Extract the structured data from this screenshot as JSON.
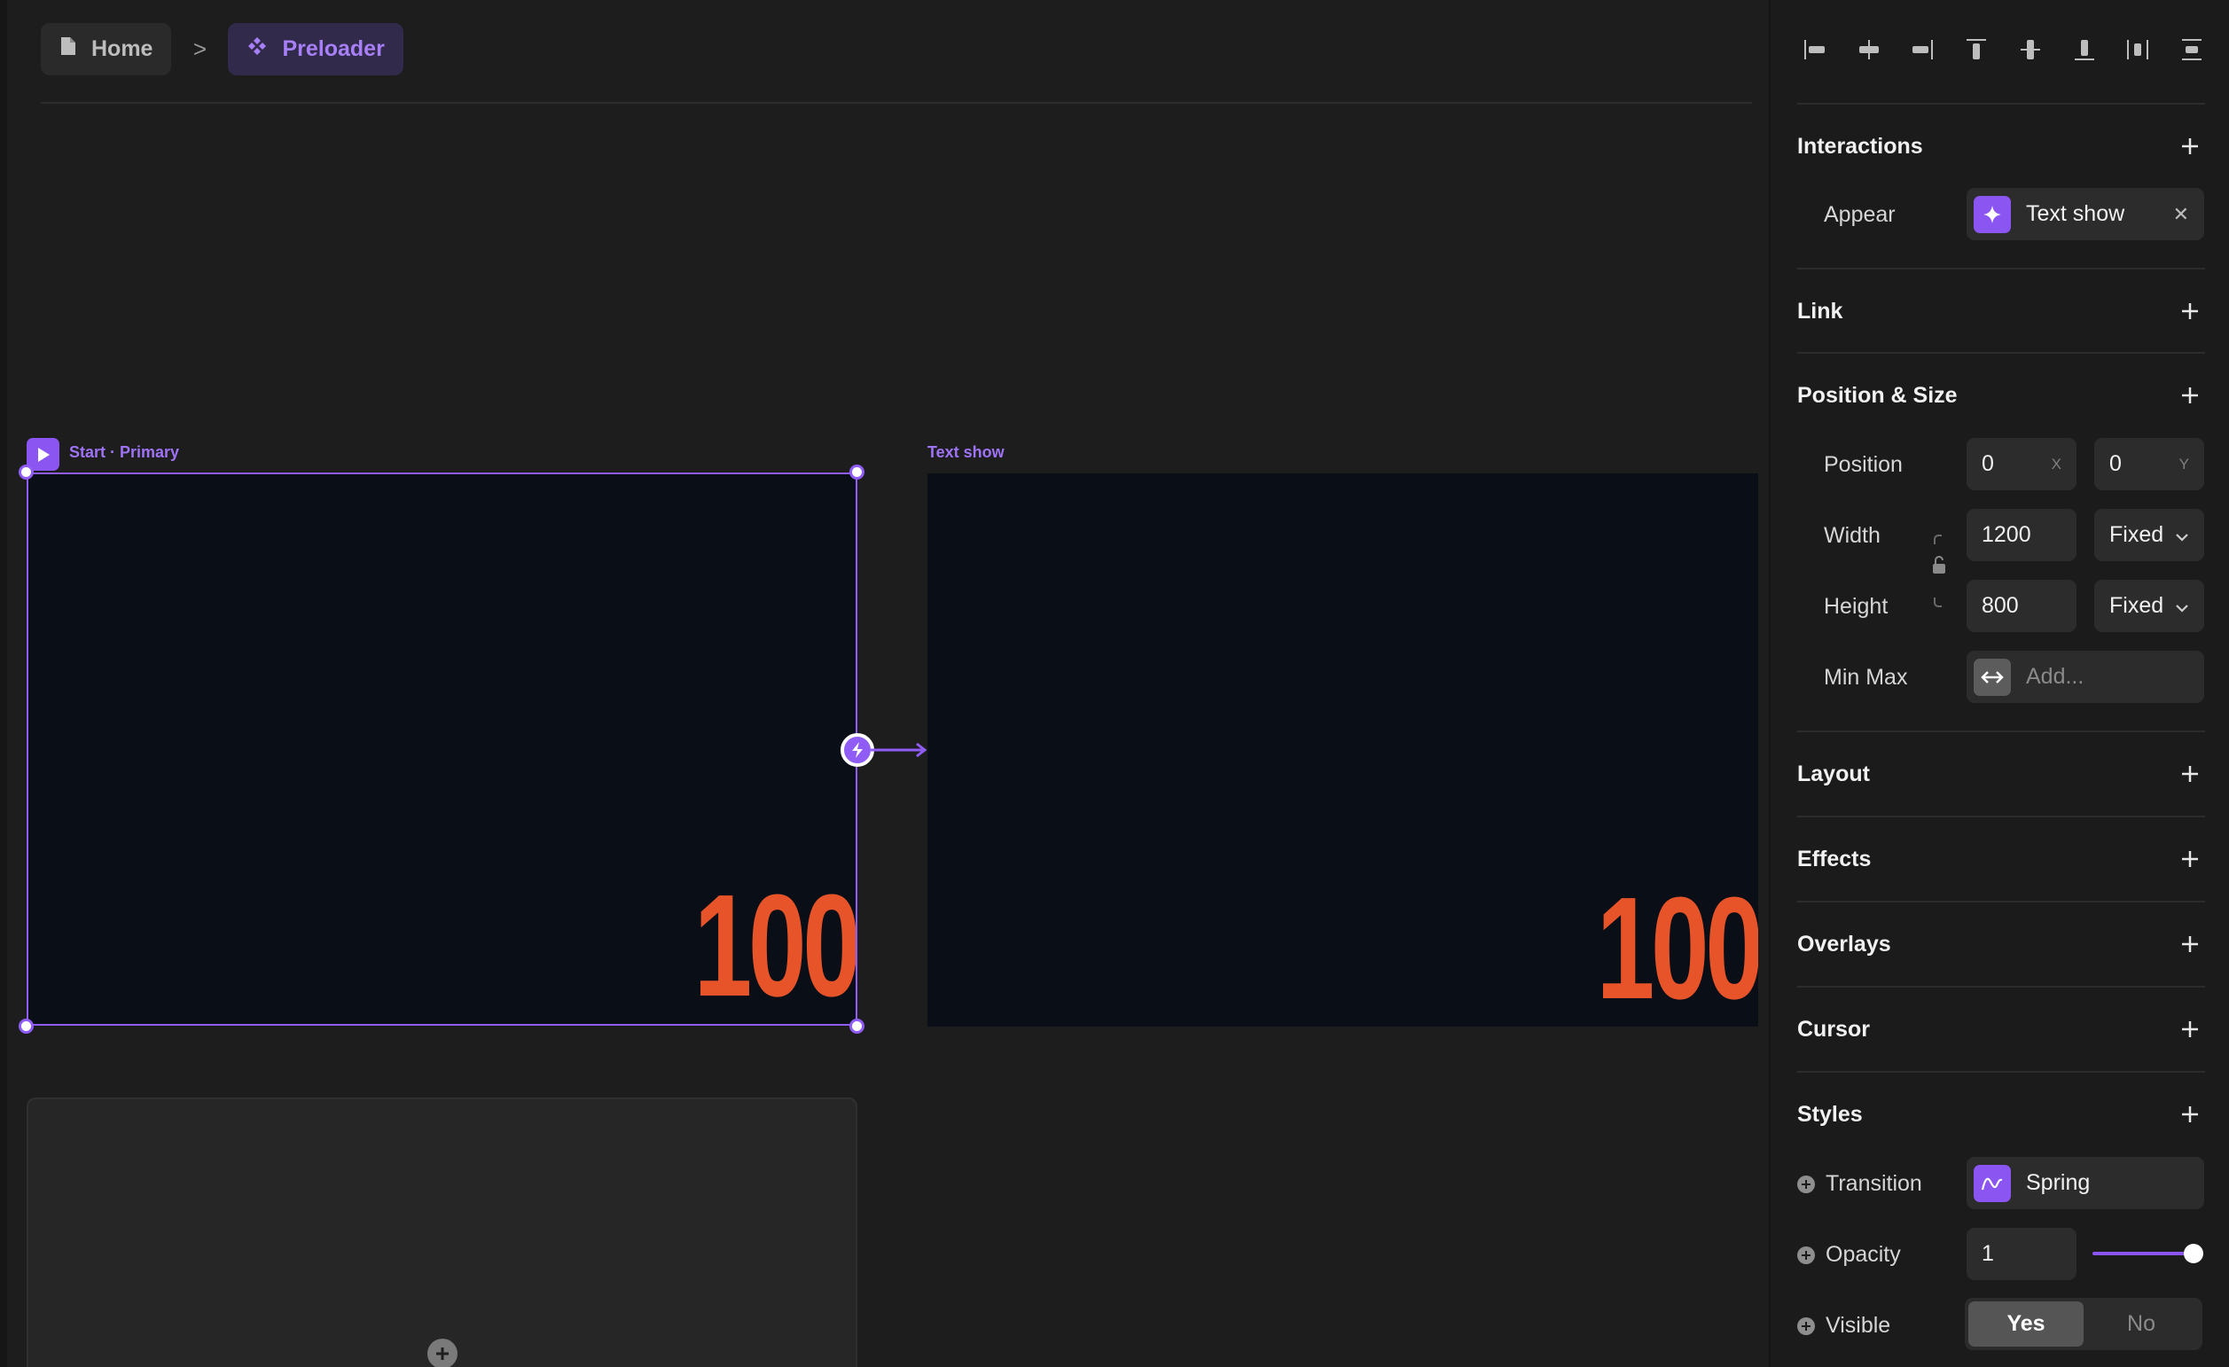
{
  "breadcrumb": {
    "home_label": "Home",
    "separator": ">",
    "current_label": "Preloader"
  },
  "canvas": {
    "primary_frame_label": "Start · Primary",
    "primary_frame_number": "100",
    "second_frame_label": "Text show",
    "second_frame_number": "100",
    "accent_color": "#8f5cf6",
    "number_color": "#e8542a",
    "frame_background": "#0a0e16"
  },
  "panel": {
    "align_icons": [
      "align-left-icon",
      "align-center-horizontal-icon",
      "align-right-icon",
      "align-top-icon",
      "align-middle-vertical-icon",
      "align-bottom-icon",
      "distribute-horizontal-icon",
      "distribute-vertical-icon"
    ],
    "interactions": {
      "title": "Interactions",
      "appear_label": "Appear",
      "appear_value": "Text show"
    },
    "link": {
      "title": "Link"
    },
    "position_size": {
      "title": "Position & Size",
      "position_label": "Position",
      "x_value": "0",
      "x_suffix": "X",
      "y_value": "0",
      "y_suffix": "Y",
      "width_label": "Width",
      "width_value": "1200",
      "width_mode": "Fixed",
      "height_label": "Height",
      "height_value": "800",
      "height_mode": "Fixed",
      "minmax_label": "Min Max",
      "minmax_placeholder": "Add..."
    },
    "layout": {
      "title": "Layout"
    },
    "effects": {
      "title": "Effects"
    },
    "overlays": {
      "title": "Overlays"
    },
    "cursor": {
      "title": "Cursor"
    },
    "styles": {
      "title": "Styles",
      "transition_label": "Transition",
      "transition_value": "Spring",
      "opacity_label": "Opacity",
      "opacity_value": "1",
      "opacity_slider_fraction": 1.0,
      "visible_label": "Visible",
      "visible_yes": "Yes",
      "visible_no": "No",
      "visible_selected": "Yes"
    }
  }
}
